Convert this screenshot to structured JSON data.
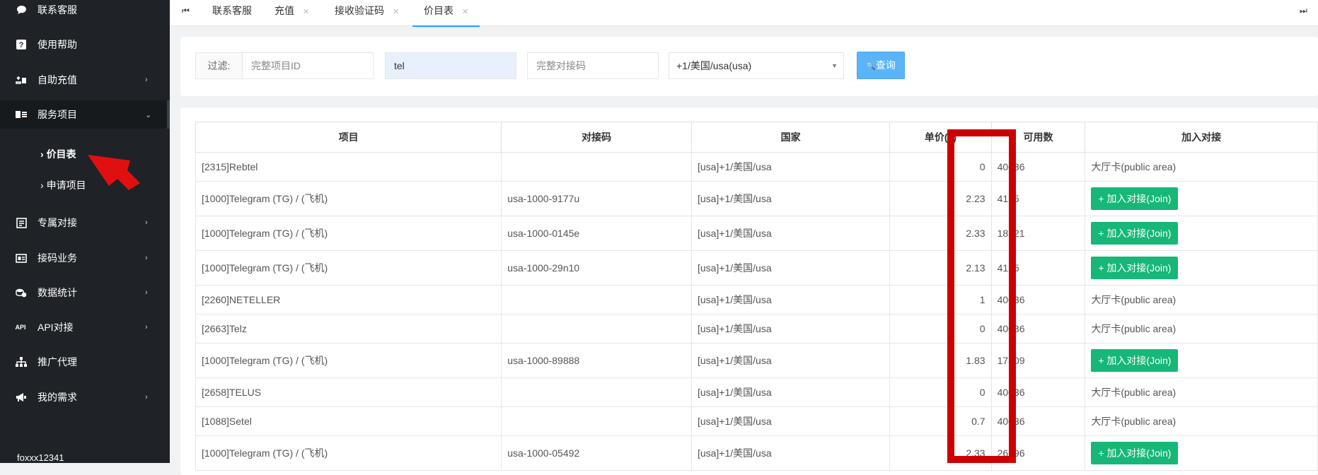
{
  "sidebar": {
    "items": [
      {
        "label": "联系客服",
        "icon": "chat-icon",
        "has_arrow": false
      },
      {
        "label": "使用帮助",
        "icon": "help-icon",
        "has_arrow": false
      },
      {
        "label": "自助充值",
        "icon": "recharge-icon",
        "has_arrow": true
      },
      {
        "label": "服务项目",
        "icon": "service-icon",
        "has_arrow": true,
        "expanded": true
      },
      {
        "label": "专属对接",
        "icon": "dedicated-icon",
        "has_arrow": true
      },
      {
        "label": "接码业务",
        "icon": "sms-icon",
        "has_arrow": true
      },
      {
        "label": "数据统计",
        "icon": "stats-icon",
        "has_arrow": true
      },
      {
        "label": "API对接",
        "icon": "api-icon",
        "icon_text": "API",
        "has_arrow": true
      },
      {
        "label": "推广代理",
        "icon": "sitemap-icon",
        "has_arrow": false
      },
      {
        "label": "我的需求",
        "icon": "megaphone-icon",
        "has_arrow": true
      }
    ],
    "submenu": [
      {
        "label": "价目表",
        "current": true
      },
      {
        "label": "申请项目",
        "current": false
      }
    ],
    "username": "foxxx12341"
  },
  "tabs": [
    {
      "label": "联系客服",
      "closable": false
    },
    {
      "label": "充值",
      "closable": true
    },
    {
      "label": "接收验证码",
      "closable": true
    },
    {
      "label": "价目表",
      "closable": true,
      "active": true
    }
  ],
  "filter": {
    "label": "过滤:",
    "project_id_placeholder": "完整项目ID",
    "keyword_value": "tel",
    "code_placeholder": "完整对接码",
    "country_selected": "+1/美国/usa(usa)",
    "query_label": "查询"
  },
  "table": {
    "headers": [
      "项目",
      "对接码",
      "国家",
      "单价(¥)",
      "可用数",
      "加入对接"
    ],
    "join_label": "+ 加入对接(Join)",
    "rows": [
      {
        "project": "[2315]Rebtel",
        "code": "",
        "country": "[usa]+1/美国/usa",
        "price": "0",
        "available": "40036",
        "join": "大厅卡(public area)"
      },
      {
        "project": "[1000]Telegram (TG) / (飞机)",
        "code": "usa-1000-9177u",
        "country": "[usa]+1/美国/usa",
        "price": "2.23",
        "available": "4125",
        "join": ""
      },
      {
        "project": "[1000]Telegram (TG) / (飞机)",
        "code": "usa-1000-0145e",
        "country": "[usa]+1/美国/usa",
        "price": "2.33",
        "available": "18121",
        "join": ""
      },
      {
        "project": "[1000]Telegram (TG) / (飞机)",
        "code": "usa-1000-29n10",
        "country": "[usa]+1/美国/usa",
        "price": "2.13",
        "available": "4125",
        "join": ""
      },
      {
        "project": "[2260]NETELLER",
        "code": "",
        "country": "[usa]+1/美国/usa",
        "price": "1",
        "available": "40036",
        "join": "大厅卡(public area)"
      },
      {
        "project": "[2663]Telz",
        "code": "",
        "country": "[usa]+1/美国/usa",
        "price": "0",
        "available": "40036",
        "join": "大厅卡(public area)"
      },
      {
        "project": "[1000]Telegram (TG) / (飞机)",
        "code": "usa-1000-89888",
        "country": "[usa]+1/美国/usa",
        "price": "1.83",
        "available": "17809",
        "join": ""
      },
      {
        "project": "[2658]TELUS",
        "code": "",
        "country": "[usa]+1/美国/usa",
        "price": "0",
        "available": "40036",
        "join": "大厅卡(public area)"
      },
      {
        "project": "[1088]Setel",
        "code": "",
        "country": "[usa]+1/美国/usa",
        "price": "0.7",
        "available": "40036",
        "join": "大厅卡(public area)"
      },
      {
        "project": "[1000]Telegram (TG) / (飞机)",
        "code": "usa-1000-05492",
        "country": "[usa]+1/美国/usa",
        "price": "2.33",
        "available": "26696",
        "join": ""
      }
    ]
  },
  "colors": {
    "sidebar_bg": "#1f2327",
    "price_green": "#0f8c2b",
    "join_green": "#16b777",
    "query_blue": "#5bb4f8",
    "highlight_red": "#cc0000"
  }
}
